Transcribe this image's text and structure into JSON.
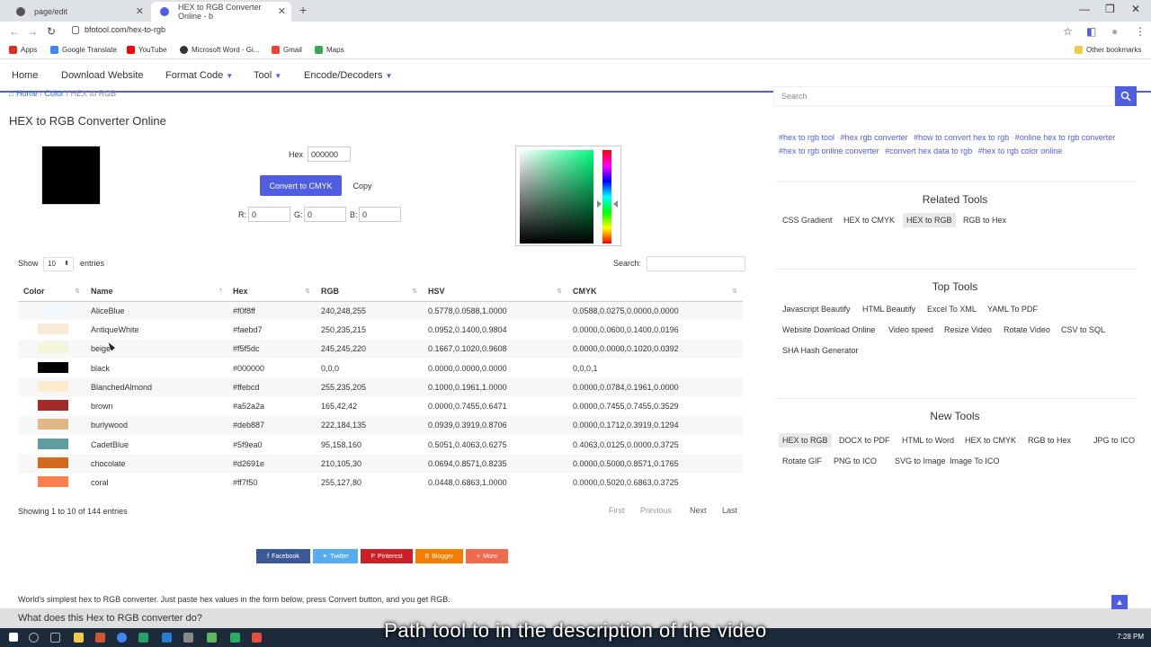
{
  "browser": {
    "tabs": [
      {
        "title": "page/edit",
        "color": "#555555"
      },
      {
        "title": "HEX to RGB Converter Online - b",
        "color": "#4f5de0"
      }
    ],
    "url": "bfotool.com/hex-to-rgb",
    "bookmarks": [
      {
        "label": "Apps",
        "color": "#d93025"
      },
      {
        "label": "Google Translate",
        "color": "#4285f4"
      },
      {
        "label": "YouTube",
        "color": "#ff0000"
      },
      {
        "label": "Microsoft Word - Gi...",
        "color": "#333333"
      },
      {
        "label": "Gmail",
        "color": "#ea4335"
      },
      {
        "label": "Maps",
        "color": "#34a853"
      }
    ],
    "other_bookmarks": "Other bookmarks"
  },
  "nav": {
    "items": [
      "Home",
      "Download Website",
      "Format Code",
      "Tool",
      "Encode/Decoders"
    ]
  },
  "breadcrumb": {
    "home": "Home",
    "sep1": "/",
    "color": "Color",
    "sep2": "/",
    "current": "HEX to RGB"
  },
  "page": {
    "title": "HEX to RGB Converter Online",
    "hex_label": "Hex",
    "hex_value": "000000",
    "convert_button": "Convert to CMYK",
    "copy_button": "Copy",
    "r_label": "R:",
    "r_value": "0",
    "g_label": "G:",
    "g_value": "0",
    "b_label": "B:",
    "b_value": "0",
    "swatch_color": "#000000"
  },
  "table": {
    "show_label": "Show",
    "entries_value": "10",
    "entries_label": "entries",
    "search_label": "Search:",
    "columns": [
      "Color",
      "Name",
      "Hex",
      "RGB",
      "HSV",
      "CMYK"
    ],
    "rows": [
      {
        "name": "AliceBlue",
        "hex": "#f0f8ff",
        "rgb": "240,248,255",
        "hsv": "0.5778,0.0588,1.0000",
        "cmyk": "0.0588,0.0275,0.0000,0.0000"
      },
      {
        "name": "AntiqueWhite",
        "hex": "#faebd7",
        "rgb": "250,235,215",
        "hsv": "0.0952,0.1400,0.9804",
        "cmyk": "0.0000,0.0600,0.1400,0.0196"
      },
      {
        "name": "beige",
        "hex": "#f5f5dc",
        "rgb": "245,245,220",
        "hsv": "0.1667,0.1020,0.9608",
        "cmyk": "0.0000,0.0000,0.1020,0.0392"
      },
      {
        "name": "black",
        "hex": "#000000",
        "rgb": "0,0,0",
        "hsv": "0.0000,0.0000,0.0000",
        "cmyk": "0,0,0,1"
      },
      {
        "name": "BlanchedAlmond",
        "hex": "#ffebcd",
        "rgb": "255,235,205",
        "hsv": "0.1000,0.1961,1.0000",
        "cmyk": "0.0000,0.0784,0.1961,0.0000"
      },
      {
        "name": "brown",
        "hex": "#a52a2a",
        "rgb": "165,42,42",
        "hsv": "0.0000,0.7455,0.6471",
        "cmyk": "0.0000,0.7455,0.7455,0.3529"
      },
      {
        "name": "burlywood",
        "hex": "#deb887",
        "rgb": "222,184,135",
        "hsv": "0.0939,0.3919,0.8706",
        "cmyk": "0.0000,0.1712,0.3919,0.1294"
      },
      {
        "name": "CadetBlue",
        "hex": "#5f9ea0",
        "rgb": "95,158,160",
        "hsv": "0.5051,0.4063,0.6275",
        "cmyk": "0.4063,0.0125,0.0000,0.3725"
      },
      {
        "name": "chocolate",
        "hex": "#d2691e",
        "rgb": "210,105,30",
        "hsv": "0.0694,0.8571,0.8235",
        "cmyk": "0.0000,0.5000,0.8571,0.1765"
      },
      {
        "name": "coral",
        "hex": "#ff7f50",
        "rgb": "255,127,80",
        "hsv": "0.0448,0.6863,1.0000",
        "cmyk": "0.0000,0.5020,0.6863,0.3725"
      }
    ],
    "info": "Showing 1 to 10 of 144 entries",
    "pagination": [
      "First",
      "Previous",
      "Next",
      "Last"
    ]
  },
  "share": [
    {
      "label": "Facebook",
      "color": "#3b5998"
    },
    {
      "label": "Twitter",
      "color": "#55acee"
    },
    {
      "label": "Pinterest",
      "color": "#cb2027"
    },
    {
      "label": "Blogger",
      "color": "#f57d00"
    },
    {
      "label": "More",
      "color": "#f06b4e"
    }
  ],
  "description": "World's simplest hex to RGB converter. Just paste hex values in the form below, press Convert button, and you get RGB.",
  "faq_heading": "What does this Hex to RGB converter do?",
  "sidebar": {
    "search_placeholder": "Search",
    "tags": [
      "#hex to rgb tool",
      "#hex rgb converter",
      "#how to convert hex to rgb",
      "#online hex to rgb converter",
      "#hex to rgb online converter",
      "#convert hex data to rgb",
      "#hex to rgb color online"
    ],
    "related_title": "Related Tools",
    "related": [
      "CSS Gradient",
      "HEX to CMYK",
      "HEX to RGB",
      "RGB to Hex"
    ],
    "top_title": "Top Tools",
    "top": [
      "Javascript Beautify",
      "HTML Beautify",
      "Excel To XML",
      "YAML To PDF",
      "Website Download Online",
      "Video speed",
      "Resize Video",
      "Rotate Video",
      "CSV to SQL",
      "SHA Hash Generator"
    ],
    "new_title": "New Tools",
    "new": [
      "HEX to RGB",
      "DOCX to PDF",
      "HTML to Word",
      "HEX to CMYK",
      "RGB to Hex",
      "JPG to ICO",
      "Rotate GIF",
      "PNG to ICO",
      "SVG to Image",
      "Image To ICO"
    ]
  },
  "caption": "Path tool to in the description of the video",
  "clock": "7:28 PM",
  "accent": "#4f5de0"
}
